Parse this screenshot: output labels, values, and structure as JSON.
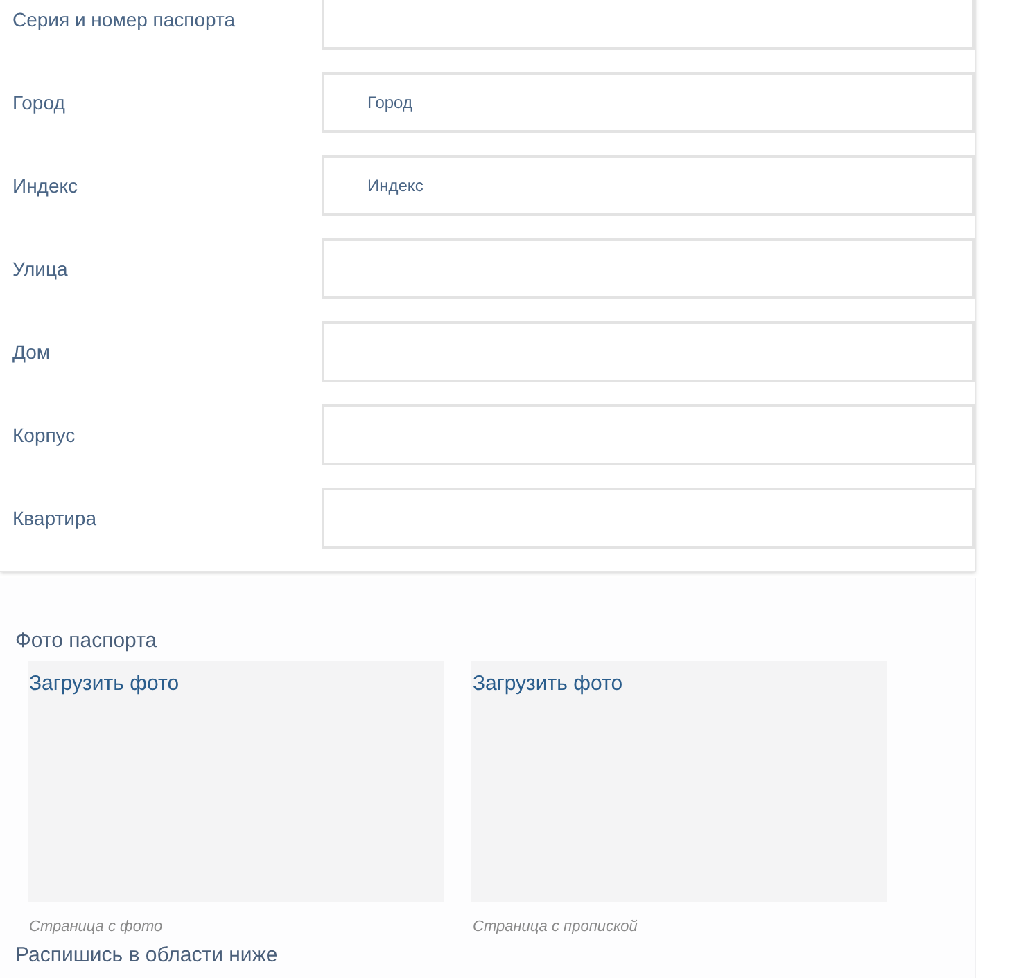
{
  "address_form": {
    "fields": [
      {
        "label": "Серия и номер паспорта"
      },
      {
        "label": "Город",
        "placeholder": "Город"
      },
      {
        "label": "Индекс",
        "placeholder": "Индекс"
      },
      {
        "label": "Улица"
      },
      {
        "label": "Дом"
      },
      {
        "label": "Корпус"
      },
      {
        "label": "Квартира"
      }
    ]
  },
  "passport_photo": {
    "title": "Фото паспорта",
    "uploads": [
      {
        "button": "Загрузить фото",
        "caption": "Страница с фото"
      },
      {
        "button": "Загрузить фото",
        "caption": "Страница с пропиской"
      }
    ]
  },
  "signature": {
    "title": "Распишись в области ниже"
  }
}
